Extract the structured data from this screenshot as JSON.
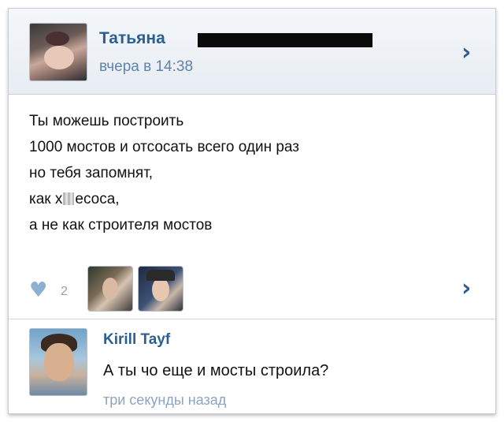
{
  "post": {
    "author": "Татьяна",
    "time": "вчера в 14:38",
    "lines": [
      "Ты можешь построить",
      "1000 мостов и отсосать всего один раз",
      "но тебя запомнят,",
      "как х",
      "есоса,",
      "а не как строителя мостов"
    ]
  },
  "likes": {
    "count": "2"
  },
  "comment": {
    "author": "Kirill Tayf",
    "text": "А ты чо еще и мосты строила?",
    "time": "три секунды назад"
  },
  "icons": {
    "chevron": "chevron-right-icon",
    "heart": "heart-icon"
  },
  "colors": {
    "link": "#2b5f93",
    "time": "#5f84ad",
    "heart": "#8eaed2"
  }
}
